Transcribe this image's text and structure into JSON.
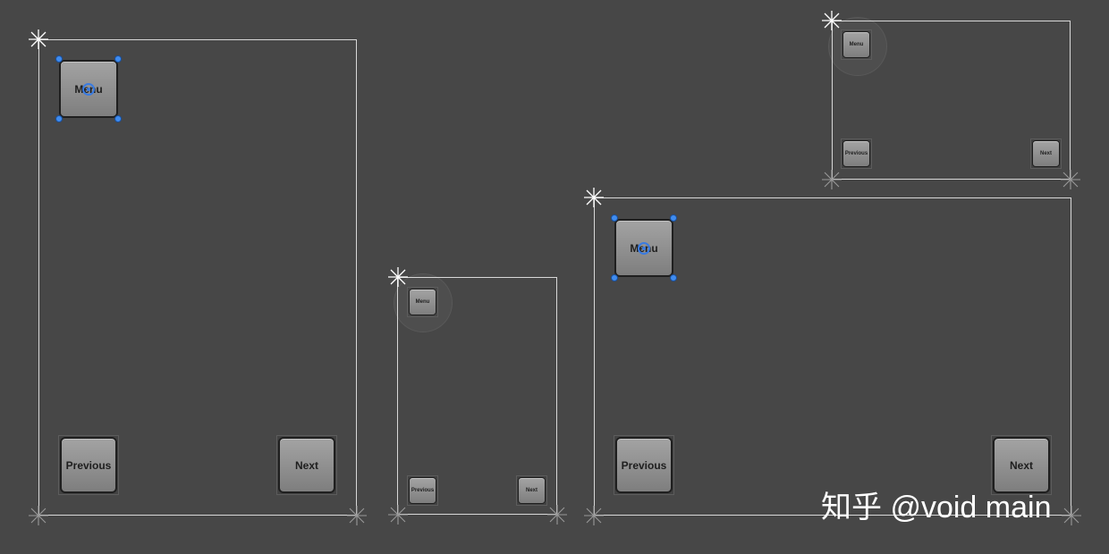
{
  "views": [
    {
      "id": "portrait-large",
      "buttons": {
        "menu": "Menu",
        "previous": "Previous",
        "next": "Next"
      }
    },
    {
      "id": "portrait-small",
      "buttons": {
        "menu": "Menu",
        "previous": "Previous",
        "next": "Next"
      }
    },
    {
      "id": "landscape-small",
      "buttons": {
        "menu": "Menu",
        "previous": "Previous",
        "next": "Next"
      }
    },
    {
      "id": "landscape-large",
      "buttons": {
        "menu": "Menu",
        "previous": "Previous",
        "next": "Next"
      }
    }
  ],
  "icons": {
    "anchor": "anchor-gizmo-icon",
    "pivot": "pivot-icon",
    "handle": "resize-handle-icon"
  },
  "colors": {
    "background": "#474747",
    "selection": "#3f8cf0",
    "canvas_border": "#d8d8d8"
  },
  "watermark": "知乎 @void main"
}
